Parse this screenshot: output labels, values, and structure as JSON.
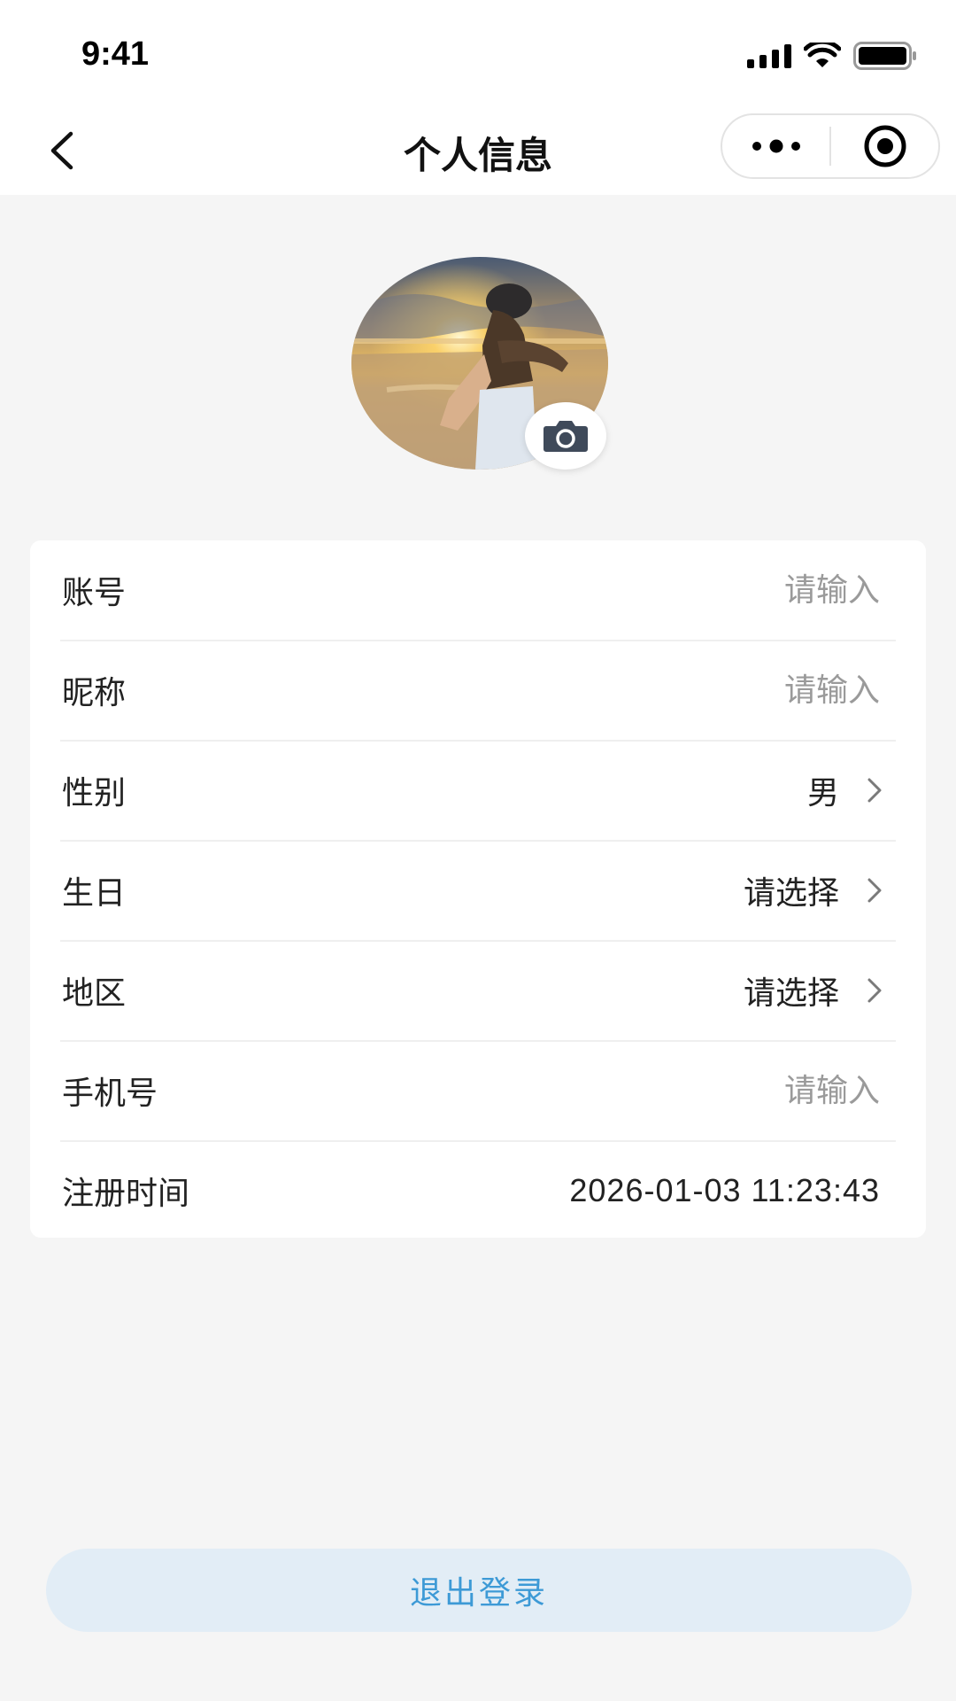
{
  "status_bar": {
    "time": "9:41"
  },
  "nav": {
    "title": "个人信息"
  },
  "avatar": {
    "camera_icon": "camera-icon"
  },
  "form": {
    "rows": [
      {
        "label": "账号",
        "placeholder": "请输入",
        "value": ""
      },
      {
        "label": "昵称",
        "placeholder": "请输入",
        "value": ""
      },
      {
        "label": "性别",
        "value": "男"
      },
      {
        "label": "生日",
        "value": "请选择"
      },
      {
        "label": "地区",
        "value": "请选择"
      },
      {
        "label": "手机号",
        "placeholder": "请输入",
        "value": ""
      },
      {
        "label": "注册时间",
        "value": "2026-01-03 11:23:43"
      }
    ]
  },
  "logout": {
    "label": "退出登录"
  },
  "colors": {
    "accent": "#3d9ad6",
    "logout_bg": "#e2edf6",
    "page_bg": "#f5f5f5"
  }
}
